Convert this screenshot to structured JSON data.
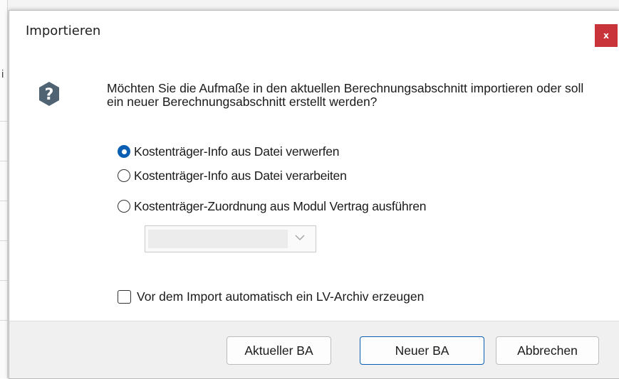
{
  "dialog": {
    "title": "Importieren",
    "close_label": "x",
    "message": "Möchten Sie die Aufmaße in den aktuellen Berechnungsabschnitt importieren oder soll ein neuer Berechnungsabschnitt erstellt werden?",
    "options": [
      {
        "label": "Kostenträger-Info aus Datei verwerfen",
        "selected": true
      },
      {
        "label": "Kostenträger-Info aus Datei verarbeiten",
        "selected": false
      },
      {
        "label": "Kostenträger-Zuordnung aus Modul Vertrag ausführen",
        "selected": false
      }
    ],
    "dropdown": {
      "value": "",
      "enabled": false
    },
    "checkbox": {
      "label": "Vor dem Import automatisch ein LV-Archiv erzeugen",
      "checked": false
    },
    "buttons": {
      "current": "Aktueller BA",
      "new": "Neuer BA",
      "cancel": "Abbrechen"
    }
  },
  "background": {
    "visible_glyph": "i"
  },
  "colors": {
    "accent": "#0b5fb3",
    "close": "#c8343a"
  }
}
